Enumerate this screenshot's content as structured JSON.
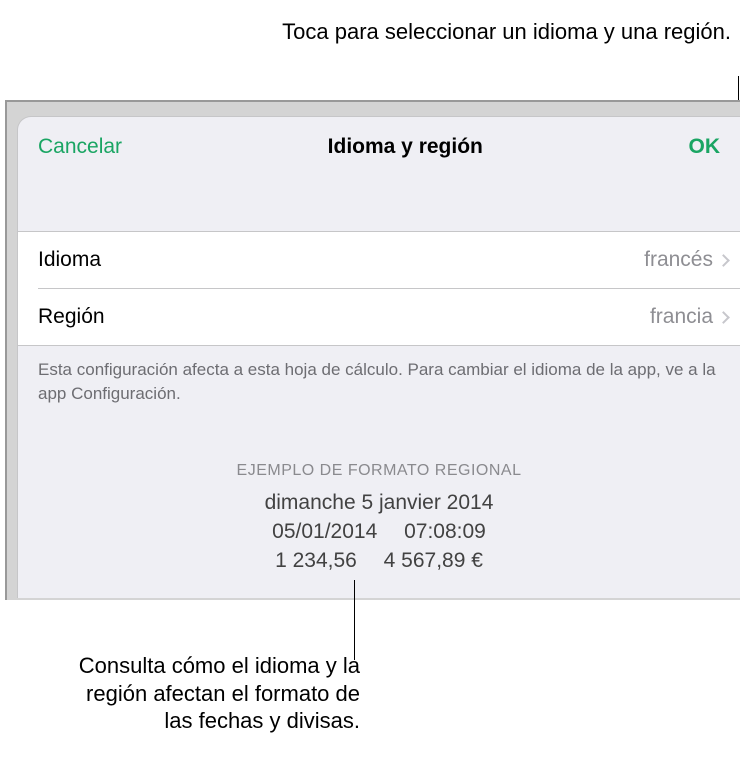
{
  "callouts": {
    "top": "Toca para seleccionar un idioma y una región.",
    "bottom": "Consulta cómo el idioma y la región afectan el formato de las fechas y divisas."
  },
  "header": {
    "cancel": "Cancelar",
    "title": "Idioma y región",
    "ok": "OK"
  },
  "rows": {
    "language": {
      "label": "Idioma",
      "value": "francés"
    },
    "region": {
      "label": "Región",
      "value": "francia"
    }
  },
  "footer": "Esta configuración afecta a esta hoja de cálculo. Para cambiar el idioma de la app, ve a la app Configuración.",
  "example": {
    "caption": "EJEMPLO DE FORMATO REGIONAL",
    "line1": "dimanche 5 janvier 2014",
    "line2": "05/01/2014  07:08:09",
    "line3": "1 234,56  4 567,89 €"
  }
}
